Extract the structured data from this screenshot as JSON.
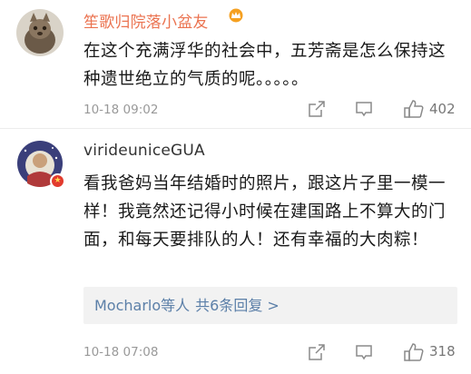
{
  "comments": [
    {
      "username": "笙歌归院落小盆友",
      "vip_icon": "crown-icon",
      "text": "在这个充满浮华的社会中，五芳斋是怎么保持这种遗世绝立的气质的呢。。。。。",
      "timestamp": "10-18 09:02",
      "likes": "402",
      "name_color": "#eb7350"
    },
    {
      "username": "virideuniceGUA",
      "text": "看我爸妈当年结婚时的照片，跟这片子里一模一样！我竟然还记得小时候在建国路上不算大的门面，和每天要排队的人！还有幸福的大肉粽！",
      "replies_preview": {
        "names": "Mocharlo等人",
        "count": "共6条回复 >"
      },
      "timestamp": "10-18 07:08",
      "likes": "318",
      "name_color": "#333333"
    }
  ],
  "icons": [
    "share-icon",
    "comment-icon",
    "like-icon",
    "crown-icon",
    "avatar-badge-icon"
  ],
  "colors": {
    "link_blue": "#5b7fa8",
    "accent_orange": "#eb7350",
    "meta_gray": "#999999"
  }
}
